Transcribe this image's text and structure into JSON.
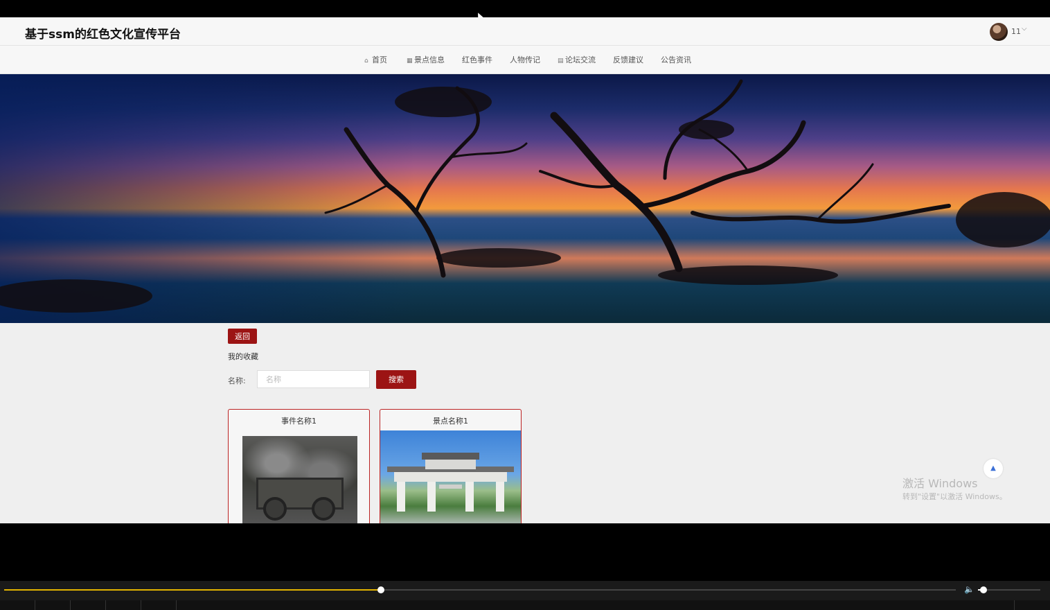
{
  "site": {
    "title": "基于ssm的红色文化宣传平台"
  },
  "user": {
    "name": "11",
    "chevron": "⌵"
  },
  "nav": {
    "items": [
      {
        "label": "首页",
        "icon": "home-icon",
        "glyph": "⌂"
      },
      {
        "label": "景点信息",
        "icon": "grid-icon",
        "glyph": "▦"
      },
      {
        "label": "红色事件",
        "icon": "",
        "glyph": ""
      },
      {
        "label": "人物传记",
        "icon": "",
        "glyph": ""
      },
      {
        "label": "论坛交流",
        "icon": "list-icon",
        "glyph": "▤"
      },
      {
        "label": "反馈建议",
        "icon": "",
        "glyph": ""
      },
      {
        "label": "公告资讯",
        "icon": "",
        "glyph": ""
      }
    ]
  },
  "content": {
    "back_label": "返回",
    "section_title": "我的收藏",
    "search": {
      "label": "名称:",
      "placeholder": "名称",
      "value": "",
      "button": "搜索"
    },
    "cards": [
      {
        "title": "事件名称1"
      },
      {
        "title": "景点名称1"
      }
    ]
  },
  "watermark": {
    "line1": "激活 Windows",
    "line2": "转到\"设置\"以激活 Windows。"
  },
  "scroll_top_glyph": "▲",
  "player": {
    "progress": 0.396,
    "volume": 0.09,
    "volume_glyph": "🔈"
  },
  "colors": {
    "accent": "#9c1414",
    "card_border": "#bb2222",
    "progress": "#e3b400"
  }
}
